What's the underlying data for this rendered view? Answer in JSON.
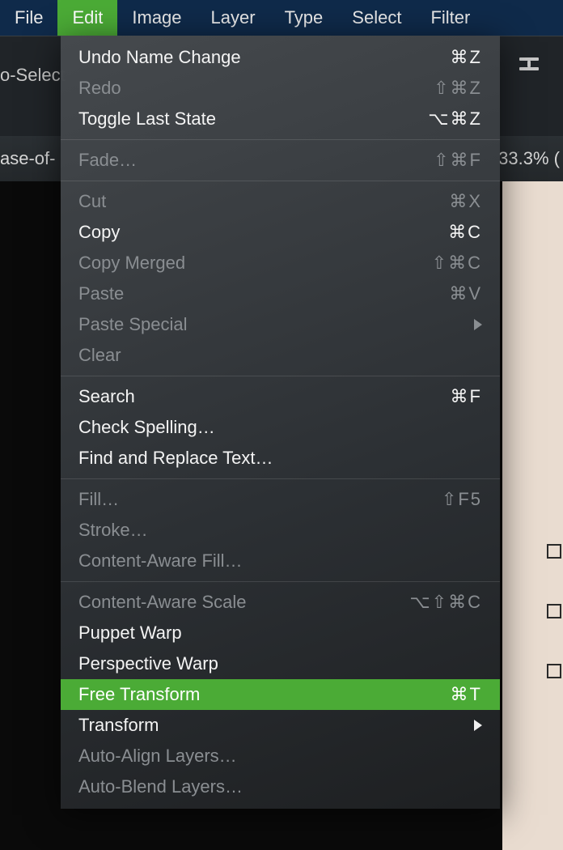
{
  "menubar": {
    "items": [
      {
        "label": "File",
        "active": false
      },
      {
        "label": "Edit",
        "active": true
      },
      {
        "label": "Image",
        "active": false
      },
      {
        "label": "Layer",
        "active": false
      },
      {
        "label": "Type",
        "active": false
      },
      {
        "label": "Select",
        "active": false
      },
      {
        "label": "Filter",
        "active": false
      }
    ]
  },
  "options_bar": {
    "auto_select_fragment": "o-Select"
  },
  "tab_bar": {
    "filename_fragment": "ase-of-",
    "zoom_fragment": "33.3% ("
  },
  "edit_menu": {
    "groups": [
      [
        {
          "label": "Undo Name Change",
          "shortcut": "⌘Z",
          "enabled": true
        },
        {
          "label": "Redo",
          "shortcut": "⇧⌘Z",
          "enabled": false
        },
        {
          "label": "Toggle Last State",
          "shortcut": "⌥⌘Z",
          "enabled": true
        }
      ],
      [
        {
          "label": "Fade…",
          "shortcut": "⇧⌘F",
          "enabled": false
        }
      ],
      [
        {
          "label": "Cut",
          "shortcut": "⌘X",
          "enabled": false
        },
        {
          "label": "Copy",
          "shortcut": "⌘C",
          "enabled": true
        },
        {
          "label": "Copy Merged",
          "shortcut": "⇧⌘C",
          "enabled": false
        },
        {
          "label": "Paste",
          "shortcut": "⌘V",
          "enabled": false
        },
        {
          "label": "Paste Special",
          "submenu": true,
          "enabled": false
        },
        {
          "label": "Clear",
          "enabled": false
        }
      ],
      [
        {
          "label": "Search",
          "shortcut": "⌘F",
          "enabled": true
        },
        {
          "label": "Check Spelling…",
          "enabled": true
        },
        {
          "label": "Find and Replace Text…",
          "enabled": true
        }
      ],
      [
        {
          "label": "Fill…",
          "shortcut": "⇧F5",
          "enabled": false
        },
        {
          "label": "Stroke…",
          "enabled": false
        },
        {
          "label": "Content-Aware Fill…",
          "enabled": false
        }
      ],
      [
        {
          "label": "Content-Aware Scale",
          "shortcut": "⌥⇧⌘C",
          "enabled": false
        },
        {
          "label": "Puppet Warp",
          "enabled": true
        },
        {
          "label": "Perspective Warp",
          "enabled": true
        },
        {
          "label": "Free Transform",
          "shortcut": "⌘T",
          "enabled": true,
          "highlight": true
        },
        {
          "label": "Transform",
          "submenu": true,
          "enabled": true
        },
        {
          "label": "Auto-Align Layers…",
          "enabled": false
        },
        {
          "label": "Auto-Blend Layers…",
          "enabled": false
        }
      ]
    ]
  }
}
